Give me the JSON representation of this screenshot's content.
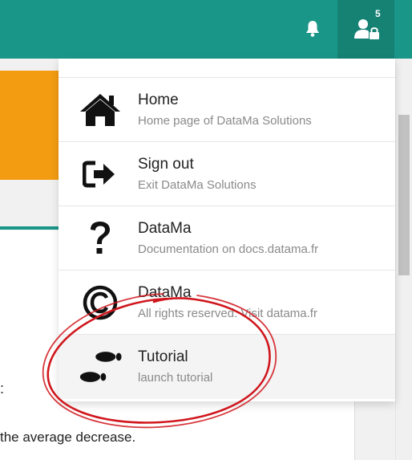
{
  "header": {
    "notifications_badge": "5",
    "bell_icon": "bell-icon",
    "user_icon": "user-lock-icon"
  },
  "background_content": {
    "colon_text": ":",
    "partial_text": "the average decrease."
  },
  "menu": {
    "items": [
      {
        "icon": "home-icon",
        "title": "Home",
        "subtitle": "Home page of DataMa Solutions"
      },
      {
        "icon": "sign-out-icon",
        "title": "Sign out",
        "subtitle": "Exit DataMa Solutions"
      },
      {
        "icon": "question-icon",
        "title": "DataMa",
        "subtitle": "Documentation on docs.datama.fr"
      },
      {
        "icon": "copyright-icon",
        "title": "DataMa",
        "subtitle": "All rights reserved. Visit datama.fr"
      },
      {
        "icon": "footprints-icon",
        "title": "Tutorial",
        "subtitle": "launch tutorial"
      }
    ]
  },
  "colors": {
    "header": "#1a9688",
    "header_dark": "#158274",
    "accent_orange": "#f39c12",
    "annotation_red": "#d0161c"
  }
}
